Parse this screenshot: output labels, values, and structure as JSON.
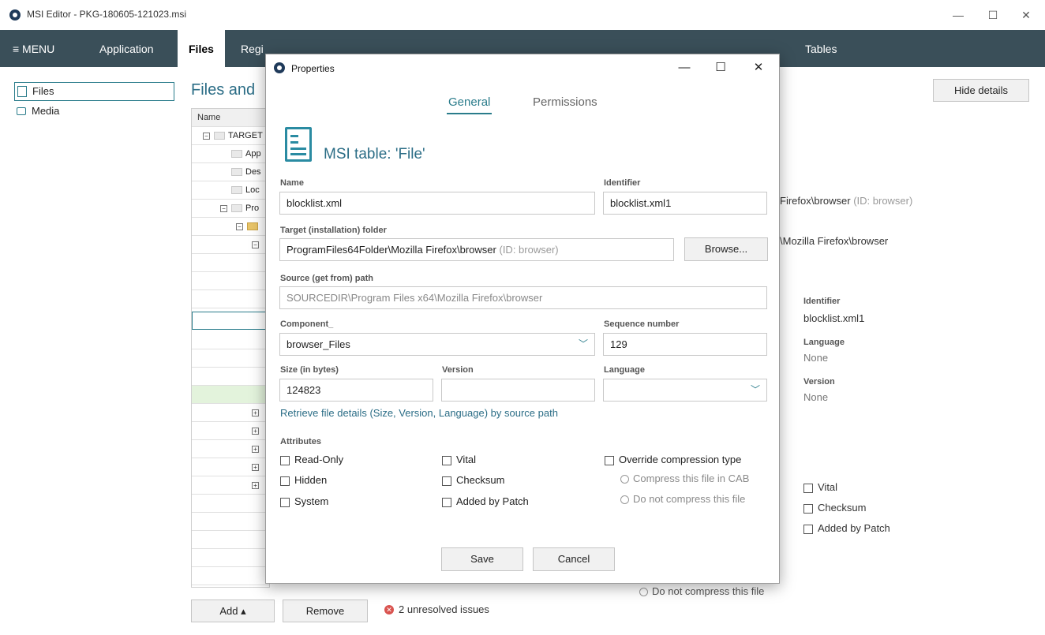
{
  "window": {
    "title": "MSI Editor - PKG-180605-121023.msi",
    "minimize": "—",
    "maximize": "☐",
    "close": "✕"
  },
  "nav": {
    "menu": "≡ MENU",
    "items": [
      "Application",
      "Files",
      "Regi",
      "Tables"
    ]
  },
  "sidebar": {
    "items": [
      {
        "label": "Files",
        "icon": "document-icon"
      },
      {
        "label": "Media",
        "icon": "drive-icon"
      }
    ]
  },
  "background": {
    "heading": "Files and",
    "table": {
      "header": "Name",
      "rows": [
        "TARGET",
        "App",
        "Des",
        "Loc",
        "Pro"
      ]
    },
    "hide_details": "Hide details",
    "path1": "Firefox\\browser",
    "path1_hint": "(ID: browser)",
    "path2": "\\Mozilla Firefox\\browser",
    "identifier_label": "Identifier",
    "identifier_value": "blocklist.xml1",
    "language_label": "Language",
    "language_value": "None",
    "version_label": "Version",
    "version_value": "None",
    "vital": "Vital",
    "checksum": "Checksum",
    "added_by_patch": "Added by Patch",
    "no_compress": "Do not compress this file"
  },
  "footer": {
    "add": "Add ▴",
    "remove": "Remove",
    "issues": "2 unresolved issues"
  },
  "dialog": {
    "title": "Properties",
    "minimize": "—",
    "maximize": "☐",
    "close": "✕",
    "tabs": {
      "general": "General",
      "permissions": "Permissions"
    },
    "heading": "MSI table: 'File'",
    "name_label": "Name",
    "name_value": "blocklist.xml",
    "identifier_label": "Identifier",
    "identifier_value": "blocklist.xml1",
    "target_label": "Target (installation) folder",
    "target_value": "ProgramFiles64Folder\\Mozilla Firefox\\browser",
    "target_hint": "(ID: browser)",
    "browse": "Browse...",
    "source_label": "Source (get from) path",
    "source_value": "SOURCEDIR\\Program Files x64\\Mozilla Firefox\\browser",
    "component_label": "Component_",
    "component_value": "browser_Files",
    "sequence_label": "Sequence number",
    "sequence_value": "129",
    "size_label": "Size (in bytes)",
    "size_value": "124823",
    "version_label": "Version",
    "version_value": "",
    "language_label": "Language",
    "language_value": "",
    "retrieve_link": "Retrieve file details (Size, Version, Language) by source path",
    "attributes_label": "Attributes",
    "attr": {
      "read_only": "Read-Only",
      "hidden": "Hidden",
      "system": "System",
      "vital": "Vital",
      "checksum": "Checksum",
      "added_by_patch": "Added by Patch",
      "override": "Override compression type",
      "compress_cab": "Compress this file in CAB",
      "no_compress": "Do not compress this file"
    },
    "save": "Save",
    "cancel": "Cancel"
  }
}
